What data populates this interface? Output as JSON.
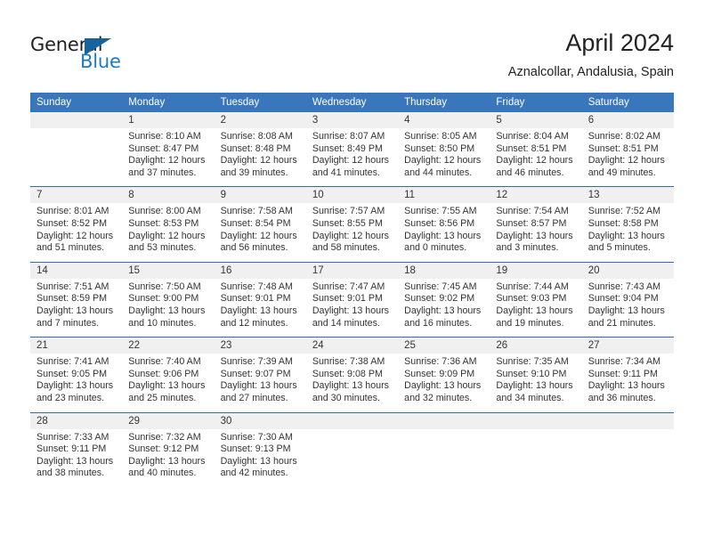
{
  "brand": {
    "name_dark": "General",
    "name_light": "Blue",
    "logo_icon": "triangle-logo-icon",
    "accent_color": "#1d7ac4"
  },
  "header": {
    "title": "April 2024",
    "subtitle": "Aznalcollar, Andalusia, Spain"
  },
  "theme": {
    "header_bg": "#3a76bc",
    "daynum_bg": "#f0f0f0",
    "separator": "#2e6daf",
    "text": "#333333"
  },
  "calendar": {
    "weekday_headers": [
      "Sunday",
      "Monday",
      "Tuesday",
      "Wednesday",
      "Thursday",
      "Friday",
      "Saturday"
    ],
    "weeks": [
      {
        "days": [
          {
            "day": "",
            "sunrise": "",
            "sunset": "",
            "daylight_line1": "",
            "daylight_line2": ""
          },
          {
            "day": "1",
            "sunrise": "Sunrise: 8:10 AM",
            "sunset": "Sunset: 8:47 PM",
            "daylight_line1": "Daylight: 12 hours",
            "daylight_line2": "and 37 minutes."
          },
          {
            "day": "2",
            "sunrise": "Sunrise: 8:08 AM",
            "sunset": "Sunset: 8:48 PM",
            "daylight_line1": "Daylight: 12 hours",
            "daylight_line2": "and 39 minutes."
          },
          {
            "day": "3",
            "sunrise": "Sunrise: 8:07 AM",
            "sunset": "Sunset: 8:49 PM",
            "daylight_line1": "Daylight: 12 hours",
            "daylight_line2": "and 41 minutes."
          },
          {
            "day": "4",
            "sunrise": "Sunrise: 8:05 AM",
            "sunset": "Sunset: 8:50 PM",
            "daylight_line1": "Daylight: 12 hours",
            "daylight_line2": "and 44 minutes."
          },
          {
            "day": "5",
            "sunrise": "Sunrise: 8:04 AM",
            "sunset": "Sunset: 8:51 PM",
            "daylight_line1": "Daylight: 12 hours",
            "daylight_line2": "and 46 minutes."
          },
          {
            "day": "6",
            "sunrise": "Sunrise: 8:02 AM",
            "sunset": "Sunset: 8:51 PM",
            "daylight_line1": "Daylight: 12 hours",
            "daylight_line2": "and 49 minutes."
          }
        ]
      },
      {
        "days": [
          {
            "day": "7",
            "sunrise": "Sunrise: 8:01 AM",
            "sunset": "Sunset: 8:52 PM",
            "daylight_line1": "Daylight: 12 hours",
            "daylight_line2": "and 51 minutes."
          },
          {
            "day": "8",
            "sunrise": "Sunrise: 8:00 AM",
            "sunset": "Sunset: 8:53 PM",
            "daylight_line1": "Daylight: 12 hours",
            "daylight_line2": "and 53 minutes."
          },
          {
            "day": "9",
            "sunrise": "Sunrise: 7:58 AM",
            "sunset": "Sunset: 8:54 PM",
            "daylight_line1": "Daylight: 12 hours",
            "daylight_line2": "and 56 minutes."
          },
          {
            "day": "10",
            "sunrise": "Sunrise: 7:57 AM",
            "sunset": "Sunset: 8:55 PM",
            "daylight_line1": "Daylight: 12 hours",
            "daylight_line2": "and 58 minutes."
          },
          {
            "day": "11",
            "sunrise": "Sunrise: 7:55 AM",
            "sunset": "Sunset: 8:56 PM",
            "daylight_line1": "Daylight: 13 hours",
            "daylight_line2": "and 0 minutes."
          },
          {
            "day": "12",
            "sunrise": "Sunrise: 7:54 AM",
            "sunset": "Sunset: 8:57 PM",
            "daylight_line1": "Daylight: 13 hours",
            "daylight_line2": "and 3 minutes."
          },
          {
            "day": "13",
            "sunrise": "Sunrise: 7:52 AM",
            "sunset": "Sunset: 8:58 PM",
            "daylight_line1": "Daylight: 13 hours",
            "daylight_line2": "and 5 minutes."
          }
        ]
      },
      {
        "days": [
          {
            "day": "14",
            "sunrise": "Sunrise: 7:51 AM",
            "sunset": "Sunset: 8:59 PM",
            "daylight_line1": "Daylight: 13 hours",
            "daylight_line2": "and 7 minutes."
          },
          {
            "day": "15",
            "sunrise": "Sunrise: 7:50 AM",
            "sunset": "Sunset: 9:00 PM",
            "daylight_line1": "Daylight: 13 hours",
            "daylight_line2": "and 10 minutes."
          },
          {
            "day": "16",
            "sunrise": "Sunrise: 7:48 AM",
            "sunset": "Sunset: 9:01 PM",
            "daylight_line1": "Daylight: 13 hours",
            "daylight_line2": "and 12 minutes."
          },
          {
            "day": "17",
            "sunrise": "Sunrise: 7:47 AM",
            "sunset": "Sunset: 9:01 PM",
            "daylight_line1": "Daylight: 13 hours",
            "daylight_line2": "and 14 minutes."
          },
          {
            "day": "18",
            "sunrise": "Sunrise: 7:45 AM",
            "sunset": "Sunset: 9:02 PM",
            "daylight_line1": "Daylight: 13 hours",
            "daylight_line2": "and 16 minutes."
          },
          {
            "day": "19",
            "sunrise": "Sunrise: 7:44 AM",
            "sunset": "Sunset: 9:03 PM",
            "daylight_line1": "Daylight: 13 hours",
            "daylight_line2": "and 19 minutes."
          },
          {
            "day": "20",
            "sunrise": "Sunrise: 7:43 AM",
            "sunset": "Sunset: 9:04 PM",
            "daylight_line1": "Daylight: 13 hours",
            "daylight_line2": "and 21 minutes."
          }
        ]
      },
      {
        "days": [
          {
            "day": "21",
            "sunrise": "Sunrise: 7:41 AM",
            "sunset": "Sunset: 9:05 PM",
            "daylight_line1": "Daylight: 13 hours",
            "daylight_line2": "and 23 minutes."
          },
          {
            "day": "22",
            "sunrise": "Sunrise: 7:40 AM",
            "sunset": "Sunset: 9:06 PM",
            "daylight_line1": "Daylight: 13 hours",
            "daylight_line2": "and 25 minutes."
          },
          {
            "day": "23",
            "sunrise": "Sunrise: 7:39 AM",
            "sunset": "Sunset: 9:07 PM",
            "daylight_line1": "Daylight: 13 hours",
            "daylight_line2": "and 27 minutes."
          },
          {
            "day": "24",
            "sunrise": "Sunrise: 7:38 AM",
            "sunset": "Sunset: 9:08 PM",
            "daylight_line1": "Daylight: 13 hours",
            "daylight_line2": "and 30 minutes."
          },
          {
            "day": "25",
            "sunrise": "Sunrise: 7:36 AM",
            "sunset": "Sunset: 9:09 PM",
            "daylight_line1": "Daylight: 13 hours",
            "daylight_line2": "and 32 minutes."
          },
          {
            "day": "26",
            "sunrise": "Sunrise: 7:35 AM",
            "sunset": "Sunset: 9:10 PM",
            "daylight_line1": "Daylight: 13 hours",
            "daylight_line2": "and 34 minutes."
          },
          {
            "day": "27",
            "sunrise": "Sunrise: 7:34 AM",
            "sunset": "Sunset: 9:11 PM",
            "daylight_line1": "Daylight: 13 hours",
            "daylight_line2": "and 36 minutes."
          }
        ]
      },
      {
        "days": [
          {
            "day": "28",
            "sunrise": "Sunrise: 7:33 AM",
            "sunset": "Sunset: 9:11 PM",
            "daylight_line1": "Daylight: 13 hours",
            "daylight_line2": "and 38 minutes."
          },
          {
            "day": "29",
            "sunrise": "Sunrise: 7:32 AM",
            "sunset": "Sunset: 9:12 PM",
            "daylight_line1": "Daylight: 13 hours",
            "daylight_line2": "and 40 minutes."
          },
          {
            "day": "30",
            "sunrise": "Sunrise: 7:30 AM",
            "sunset": "Sunset: 9:13 PM",
            "daylight_line1": "Daylight: 13 hours",
            "daylight_line2": "and 42 minutes."
          },
          {
            "day": "",
            "sunrise": "",
            "sunset": "",
            "daylight_line1": "",
            "daylight_line2": ""
          },
          {
            "day": "",
            "sunrise": "",
            "sunset": "",
            "daylight_line1": "",
            "daylight_line2": ""
          },
          {
            "day": "",
            "sunrise": "",
            "sunset": "",
            "daylight_line1": "",
            "daylight_line2": ""
          },
          {
            "day": "",
            "sunrise": "",
            "sunset": "",
            "daylight_line1": "",
            "daylight_line2": ""
          }
        ]
      }
    ]
  }
}
